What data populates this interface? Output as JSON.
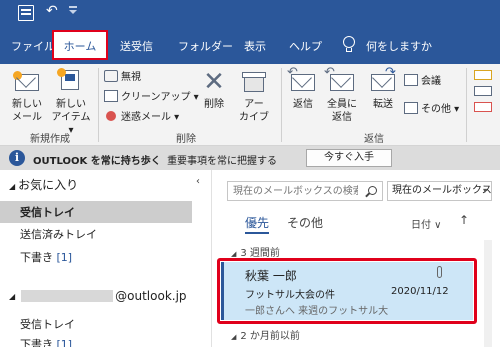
{
  "quick_access": {
    "app_icon": "outlook-app-icon",
    "undo_icon": "undo-icon",
    "more_icon": "customize-qat-icon"
  },
  "tabs": [
    {
      "label": "ファイル",
      "active": false
    },
    {
      "label": "ホーム",
      "active": true
    },
    {
      "label": "送受信",
      "active": false
    },
    {
      "label": "フォルダー",
      "active": false
    },
    {
      "label": "表示",
      "active": false
    },
    {
      "label": "ヘルプ",
      "active": false
    }
  ],
  "tell_me": {
    "icon": "lightbulb-icon",
    "label": "何をしますか"
  },
  "ribbon": {
    "new_group": {
      "label": "新規作成",
      "new_mail": "新しい\nメール",
      "new_items": "新しい\nアイテム ▾"
    },
    "delete_group": {
      "label": "削除",
      "ignore": "無視",
      "cleanup": "クリーンアップ ▾",
      "junk": "迷惑メール ▾",
      "delete": "削除",
      "archive": "アー\nカイブ"
    },
    "respond_group": {
      "label": "返信",
      "reply": "返信",
      "reply_all": "全員に\n返信",
      "forward": "転送",
      "meeting": "会議",
      "more": "その他 ▾"
    }
  },
  "infobar": {
    "icon": "info-icon",
    "bold_text": "OUTLOOK を常に持ち歩く",
    "text": "重要事項を常に把握する",
    "button": "今すぐ入手"
  },
  "folders": {
    "favorites_header": "お気に入り",
    "favorites": [
      {
        "label": "受信トレイ",
        "count": "",
        "selected": true
      },
      {
        "label": "送信済みトレイ",
        "count": "",
        "selected": false
      },
      {
        "label": "下書き",
        "count": "[1]",
        "selected": false
      }
    ],
    "account_suffix": "@outlook.jp",
    "account_items": [
      {
        "label": "受信トレイ",
        "count": ""
      },
      {
        "label": "下書き",
        "count": "[1]"
      }
    ]
  },
  "message_list": {
    "search_placeholder": "現在のメールボックスの検索",
    "scope": "現在のメールボックス",
    "focused_tab": "優先",
    "other_tab": "その他",
    "sort_by": "日付 ∨",
    "sort_direction": "↑",
    "groups": [
      {
        "label": "3 週間前"
      },
      {
        "label": "2 か月前以前"
      }
    ],
    "messages": [
      {
        "sender": "秋葉 一郎",
        "subject": "フットサル大会の件",
        "date": "2020/11/12",
        "preview": "一郎さんへ  来週のフットサル大",
        "has_attachment": true,
        "selected": true
      }
    ]
  },
  "colors": {
    "accent": "#2b579a",
    "highlight_box": "#e0001b",
    "selected_message": "#cde6f7"
  }
}
